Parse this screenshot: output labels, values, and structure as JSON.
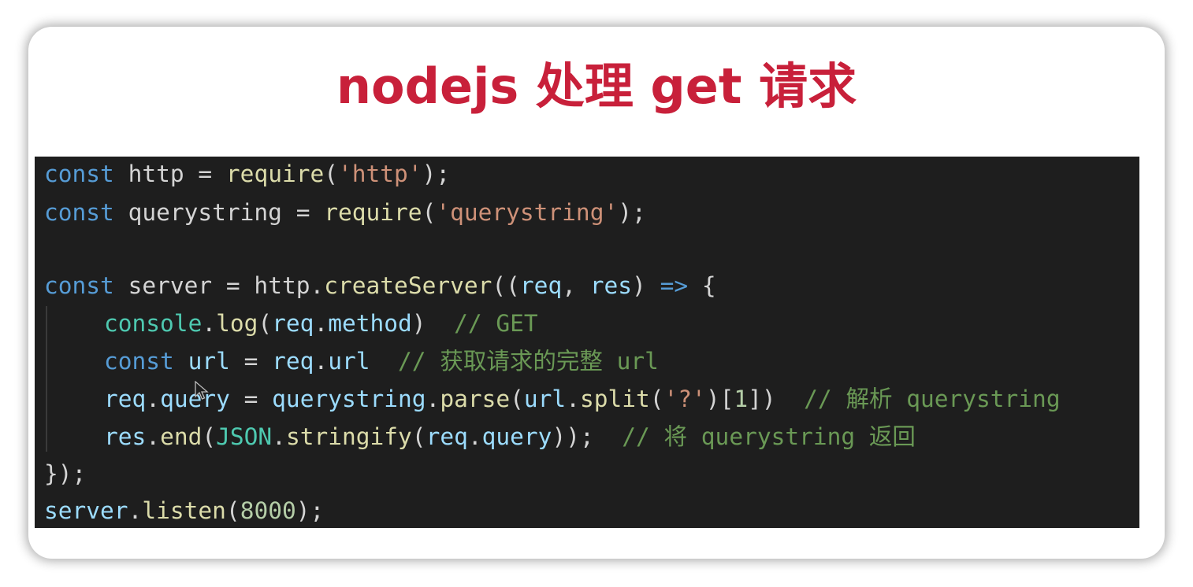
{
  "slide": {
    "title": "nodejs 处理 get 请求",
    "title_color": "#c8203a"
  },
  "colors": {
    "keyword": "#569cd6",
    "identifier": "#d4d4d4",
    "function": "#dcdcaa",
    "string": "#ce9178",
    "comment": "#6a9955",
    "variable": "#9cdcfe",
    "class": "#4ec9b0",
    "number": "#b5cea8",
    "background": "#1e1e1e"
  },
  "code": {
    "lines": [
      {
        "indent": false,
        "tokens": [
          {
            "t": "const",
            "c": "keyword"
          },
          {
            "t": " http ",
            "c": "identifier"
          },
          {
            "t": "=",
            "c": "identifier"
          },
          {
            "t": " ",
            "c": "identifier"
          },
          {
            "t": "require",
            "c": "function"
          },
          {
            "t": "(",
            "c": "identifier"
          },
          {
            "t": "'http'",
            "c": "string"
          },
          {
            "t": ");",
            "c": "identifier"
          }
        ]
      },
      {
        "indent": false,
        "tokens": [
          {
            "t": "const",
            "c": "keyword"
          },
          {
            "t": " querystring ",
            "c": "identifier"
          },
          {
            "t": "=",
            "c": "identifier"
          },
          {
            "t": " ",
            "c": "identifier"
          },
          {
            "t": "require",
            "c": "function"
          },
          {
            "t": "(",
            "c": "identifier"
          },
          {
            "t": "'querystring'",
            "c": "string"
          },
          {
            "t": ");",
            "c": "identifier"
          }
        ]
      },
      {
        "indent": false,
        "tokens": []
      },
      {
        "indent": false,
        "tokens": [
          {
            "t": "const",
            "c": "keyword"
          },
          {
            "t": " server ",
            "c": "identifier"
          },
          {
            "t": "=",
            "c": "identifier"
          },
          {
            "t": " http.",
            "c": "identifier"
          },
          {
            "t": "createServer",
            "c": "function"
          },
          {
            "t": "((",
            "c": "identifier"
          },
          {
            "t": "req",
            "c": "variable"
          },
          {
            "t": ", ",
            "c": "identifier"
          },
          {
            "t": "res",
            "c": "variable"
          },
          {
            "t": ") ",
            "c": "identifier"
          },
          {
            "t": "=>",
            "c": "keyword"
          },
          {
            "t": " {",
            "c": "identifier"
          }
        ]
      },
      {
        "indent": true,
        "tokens": [
          {
            "t": "console",
            "c": "class"
          },
          {
            "t": ".",
            "c": "identifier"
          },
          {
            "t": "log",
            "c": "function"
          },
          {
            "t": "(",
            "c": "identifier"
          },
          {
            "t": "req",
            "c": "variable"
          },
          {
            "t": ".",
            "c": "identifier"
          },
          {
            "t": "method",
            "c": "variable"
          },
          {
            "t": ")  ",
            "c": "identifier"
          },
          {
            "t": "// GET",
            "c": "comment"
          }
        ]
      },
      {
        "indent": true,
        "tokens": [
          {
            "t": "const",
            "c": "keyword"
          },
          {
            "t": " url ",
            "c": "variable"
          },
          {
            "t": "=",
            "c": "identifier"
          },
          {
            "t": " ",
            "c": "identifier"
          },
          {
            "t": "req",
            "c": "variable"
          },
          {
            "t": ".",
            "c": "identifier"
          },
          {
            "t": "url",
            "c": "variable"
          },
          {
            "t": "  ",
            "c": "identifier"
          },
          {
            "t": "// 获取请求的完整 url",
            "c": "comment"
          }
        ]
      },
      {
        "indent": true,
        "tokens": [
          {
            "t": "req",
            "c": "variable"
          },
          {
            "t": ".",
            "c": "identifier"
          },
          {
            "t": "query",
            "c": "variable"
          },
          {
            "t": " = ",
            "c": "identifier"
          },
          {
            "t": "querystring",
            "c": "variable"
          },
          {
            "t": ".",
            "c": "identifier"
          },
          {
            "t": "parse",
            "c": "function"
          },
          {
            "t": "(",
            "c": "identifier"
          },
          {
            "t": "url",
            "c": "variable"
          },
          {
            "t": ".",
            "c": "identifier"
          },
          {
            "t": "split",
            "c": "function"
          },
          {
            "t": "(",
            "c": "identifier"
          },
          {
            "t": "'?'",
            "c": "string"
          },
          {
            "t": ")[",
            "c": "identifier"
          },
          {
            "t": "1",
            "c": "number"
          },
          {
            "t": "])  ",
            "c": "identifier"
          },
          {
            "t": "// 解析 querystring",
            "c": "comment"
          }
        ]
      },
      {
        "indent": true,
        "tokens": [
          {
            "t": "res",
            "c": "variable"
          },
          {
            "t": ".",
            "c": "identifier"
          },
          {
            "t": "end",
            "c": "function"
          },
          {
            "t": "(",
            "c": "identifier"
          },
          {
            "t": "JSON",
            "c": "class"
          },
          {
            "t": ".",
            "c": "identifier"
          },
          {
            "t": "stringify",
            "c": "function"
          },
          {
            "t": "(",
            "c": "identifier"
          },
          {
            "t": "req",
            "c": "variable"
          },
          {
            "t": ".",
            "c": "identifier"
          },
          {
            "t": "query",
            "c": "variable"
          },
          {
            "t": "));  ",
            "c": "identifier"
          },
          {
            "t": "// 将 querystring 返回",
            "c": "comment"
          }
        ]
      },
      {
        "indent": false,
        "tokens": [
          {
            "t": "});",
            "c": "identifier"
          }
        ]
      },
      {
        "indent": false,
        "tokens": [
          {
            "t": "server",
            "c": "variable"
          },
          {
            "t": ".",
            "c": "identifier"
          },
          {
            "t": "listen",
            "c": "function"
          },
          {
            "t": "(",
            "c": "identifier"
          },
          {
            "t": "8000",
            "c": "number"
          },
          {
            "t": ");",
            "c": "identifier"
          }
        ]
      }
    ]
  }
}
